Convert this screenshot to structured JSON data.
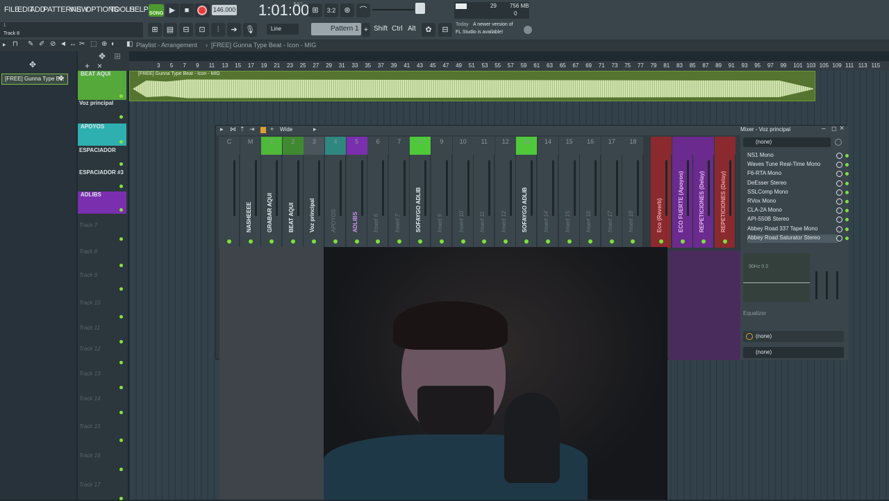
{
  "menu": [
    "FILE",
    "EDIT",
    "ADD",
    "PATTERNS",
    "VIEW",
    "OPTIONS",
    "TOOLS",
    "HELP"
  ],
  "transport": {
    "song_label": "SONG",
    "tempo": "146.000",
    "time": "1:01:00",
    "time_unit": "B:S:T"
  },
  "monitor": {
    "cpu": "29",
    "ram": "756 MB",
    "poly": "0"
  },
  "hint": {
    "line1": "1",
    "line2": "Track 8"
  },
  "toolbar2": {
    "snap": "Line",
    "pattern": "Pattern 1",
    "shift": "Shift",
    "ctrl": "Ctrl",
    "alt": "Alt"
  },
  "news": {
    "today": "Today",
    "text1": "A newer version of",
    "text2": "FL Studio is available!"
  },
  "playlist": {
    "breadcrumb": "Playlist - Arrangement",
    "sep": "›",
    "project": "[FREE] Gunna Type Beat - Icon - MIG",
    "pattern_selected": "[FREE] Gunna Type B..."
  },
  "ruler": [
    "3",
    "5",
    "7",
    "9",
    "11",
    "13",
    "15",
    "17",
    "19",
    "21",
    "23",
    "25",
    "27",
    "29",
    "31",
    "33",
    "35",
    "37",
    "39",
    "41",
    "43",
    "45",
    "47",
    "49",
    "51",
    "53",
    "55",
    "57",
    "59",
    "61",
    "63",
    "65",
    "67",
    "69",
    "71",
    "73",
    "75",
    "77",
    "79",
    "81",
    "83",
    "85",
    "87",
    "89",
    "91",
    "93",
    "95",
    "97",
    "99",
    "101",
    "103",
    "105",
    "109",
    "111",
    "113",
    "115"
  ],
  "tracks": [
    {
      "name": "BEAT AQUI",
      "active": true
    },
    {
      "name": "Voz principal",
      "active": true
    },
    {
      "name": "APOYOS",
      "active": true
    },
    {
      "name": "ESPACIADOR",
      "active": true
    },
    {
      "name": "ESPACIADOR #3",
      "active": true
    },
    {
      "name": "ADLIBS",
      "active": true
    },
    {
      "name": "Track 7",
      "active": false
    },
    {
      "name": "Track 8",
      "active": false
    },
    {
      "name": "Track 9",
      "active": false
    },
    {
      "name": "Track 10",
      "active": false
    },
    {
      "name": "Track 11",
      "active": false
    },
    {
      "name": "Track 12",
      "active": false
    },
    {
      "name": "Track 13",
      "active": false
    },
    {
      "name": "Track 14",
      "active": false
    },
    {
      "name": "Track 15",
      "active": false
    },
    {
      "name": "Track 16",
      "active": false
    },
    {
      "name": "Track 17",
      "active": false
    }
  ],
  "clip": {
    "label": "[FREE] Gunna Type Beat - Icon - MIG"
  },
  "mixer": {
    "view_label": "Wide",
    "title": "Mixer - Voz principal",
    "strips": [
      {
        "num": "C",
        "name": "",
        "active": false,
        "color": "#3a464c"
      },
      {
        "num": "M",
        "name": "NASHEEEE",
        "active": true,
        "color": "#3a464c"
      },
      {
        "num": "1",
        "name": "GRABAR AQUI",
        "active": true,
        "color": "#4fb93a"
      },
      {
        "num": "2",
        "name": "BEAT AQUI",
        "active": true,
        "color": "#3f8a31"
      },
      {
        "num": "3",
        "name": "Voz principal",
        "active": true,
        "color": "#4a565c"
      },
      {
        "num": "4",
        "name": "APOYOS",
        "active": false,
        "color": "#2f8880"
      },
      {
        "num": "5",
        "name": "ADLIBS",
        "active": true,
        "color": "#7a2fae"
      },
      {
        "num": "6",
        "name": "Insert 6",
        "active": false,
        "color": "#3a464c"
      },
      {
        "num": "7",
        "name": "Insert 7",
        "active": false,
        "color": "#3a464c"
      },
      {
        "num": "8",
        "name": "SOFAYGO ADLIB",
        "active": true,
        "color": "#4fc93a"
      },
      {
        "num": "9",
        "name": "Insert 9",
        "active": false,
        "color": "#3a464c"
      },
      {
        "num": "10",
        "name": "Insert 10",
        "active": false,
        "color": "#3a464c"
      },
      {
        "num": "11",
        "name": "Insert 11",
        "active": false,
        "color": "#3a464c"
      },
      {
        "num": "12",
        "name": "Insert 12",
        "active": false,
        "color": "#3a464c"
      },
      {
        "num": "13",
        "name": "SOFAYGO ADLIB",
        "active": true,
        "color": "#4fc93a"
      },
      {
        "num": "14",
        "name": "Insert 14",
        "active": false,
        "color": "#3a464c"
      },
      {
        "num": "15",
        "name": "Insert 15",
        "active": false,
        "color": "#3a464c"
      },
      {
        "num": "16",
        "name": "Insert 16",
        "active": false,
        "color": "#3a464c"
      },
      {
        "num": "17",
        "name": "Insert 17",
        "active": false,
        "color": "#3a464c"
      },
      {
        "num": "18",
        "name": "Insert 18",
        "active": false,
        "color": "#3a464c"
      },
      {
        "num": "",
        "name": "Eco (Reverb)",
        "active": true,
        "color": "#8a2a2e"
      },
      {
        "num": "",
        "name": "ECO FUERTE (Apoyos)",
        "active": true,
        "color": "#6a2a8e"
      },
      {
        "num": "",
        "name": "REPETICIONES (Delay)",
        "active": true,
        "color": "#6a2a8e"
      },
      {
        "num": "",
        "name": "REPETICIONES (Delay)",
        "active": true,
        "color": "#8a2a2e"
      }
    ],
    "input": "(none)",
    "fx": [
      "NS1 Mono",
      "Waves Tune Real-Time Mono",
      "F6-RTA Mono",
      "DeEsser Stereo",
      "SSLComp Mono",
      "RVox Mono",
      "CLA-2A Mono",
      "API-550B Stereo",
      "Abbey Road 337 Tape Mono",
      "Abbey Road Saturator Stereo"
    ],
    "eq_label": "Equalizer",
    "eq_readout": "90Hz 0.3",
    "output1": "(none)",
    "output2": "(none)"
  },
  "colors": {
    "accent_green": "#7fe03a",
    "purple": "#7a2fae",
    "teal": "#2fb0b0"
  }
}
